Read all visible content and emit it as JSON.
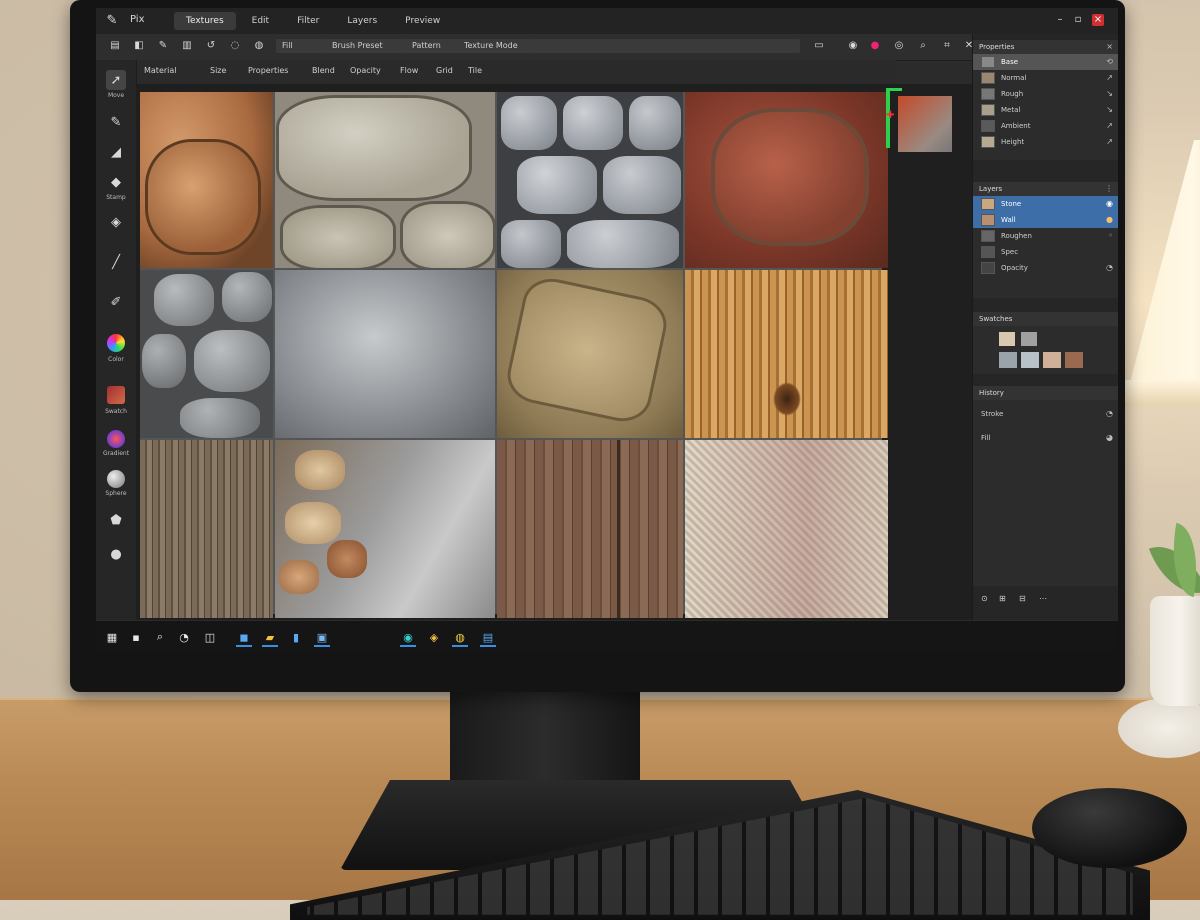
{
  "window": {
    "title": "Pix"
  },
  "menu": {
    "items": [
      "Textures",
      "Edit",
      "Filter",
      "Layers",
      "Preview"
    ],
    "active_index": 0
  },
  "toolbar": {
    "fields": [
      "Fill",
      "Brush Preset",
      "Pattern",
      "Texture Mode"
    ]
  },
  "options_bar": {
    "items": [
      "Material",
      "Size",
      "Properties",
      "Blend",
      "Opacity",
      "Flow",
      "Grid",
      "Tile"
    ]
  },
  "tools": {
    "labels": [
      "Move",
      "Brush",
      "Eraser",
      "Stamp",
      "Smudge",
      "Pen",
      "Pencil",
      "Color",
      "Swatch",
      "Gradient",
      "Sphere",
      "Bucket",
      "Blur"
    ]
  },
  "panels": {
    "properties": {
      "title": "Properties",
      "selected": "Base",
      "rows": [
        "Normal",
        "Rough",
        "Metal",
        "Ambient",
        "Height"
      ]
    },
    "layers": {
      "title": "Layers",
      "rows": [
        "Stone",
        "Wall",
        "Roughen",
        "Spec",
        "Opacity"
      ]
    },
    "swatches": {
      "title": "Swatches"
    },
    "history": {
      "title": "History",
      "rows": [
        "Stroke",
        "Fill"
      ]
    }
  },
  "colors": {
    "accent": "#3e6ea8",
    "taskbar_indicator": "#3a8ee6",
    "close": "#d23030"
  }
}
